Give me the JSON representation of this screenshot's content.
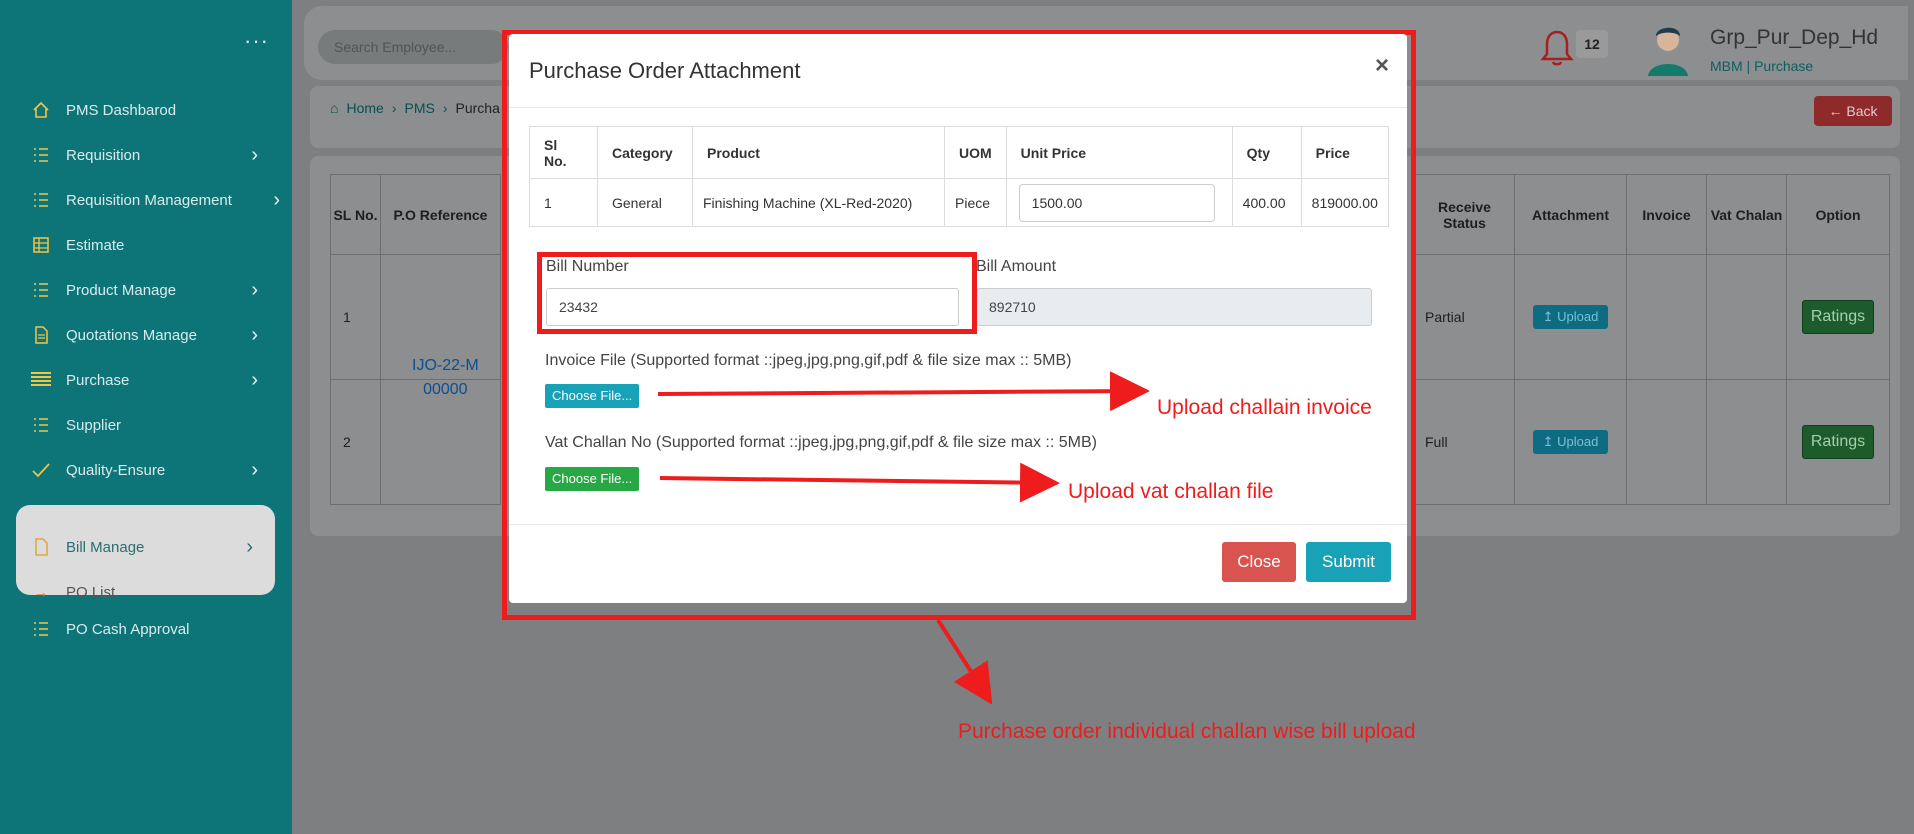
{
  "sidebar": {
    "items": [
      {
        "label": "PMS Dashbarod",
        "icon": "home-icon",
        "chevron": false
      },
      {
        "label": "Requisition",
        "icon": "list-icon",
        "chevron": true
      },
      {
        "label": "Requisition Management",
        "icon": "list-icon",
        "chevron": true
      },
      {
        "label": "Estimate",
        "icon": "table-icon",
        "chevron": false
      },
      {
        "label": "Product Manage",
        "icon": "list-icon",
        "chevron": true
      },
      {
        "label": "Quotations Manage",
        "icon": "document-icon",
        "chevron": true
      },
      {
        "label": "Purchase",
        "icon": "list-icon",
        "chevron": true
      },
      {
        "label": "Supplier",
        "icon": "list-icon",
        "chevron": false
      },
      {
        "label": "Quality-Ensure",
        "icon": "check-icon",
        "chevron": true
      }
    ],
    "active_item": {
      "label": "Bill Manage",
      "icon": "document-icon"
    },
    "sub_item": {
      "label": "PO List",
      "icon": "arrow-right-icon"
    },
    "extra_item": {
      "label": "PO Cash Approval",
      "icon": "list-icon"
    }
  },
  "header": {
    "search_placeholder": "Search Employee...",
    "notification_count": "12",
    "user_name": "Grp_Pur_Dep_Hd",
    "user_role": "MBM  | Purchase"
  },
  "breadcrumb": {
    "home": "Home",
    "pms": "PMS",
    "current": "Purcha"
  },
  "back_button": "Back",
  "background_table": {
    "left_headers": [
      "SL No.",
      "P.O Reference"
    ],
    "rows": [
      {
        "sl": "1"
      },
      {
        "sl": "2"
      }
    ],
    "po_reference": [
      "IJO-22-M",
      "00000"
    ],
    "right_headers": [
      "Receive Status",
      "Attachment",
      "Invoice",
      "Vat Chalan",
      "Option"
    ],
    "right_rows": [
      {
        "status": "Partial",
        "attachment": "Upload",
        "option": "Ratings"
      },
      {
        "status": "Full",
        "attachment": "Upload",
        "option": "Ratings"
      }
    ]
  },
  "modal": {
    "title": "Purchase Order Attachment",
    "close_symbol": "×",
    "table": {
      "headers": [
        "Sl No.",
        "Category",
        "Product",
        "UOM",
        "Unit Price",
        "Qty",
        "Price"
      ],
      "row": {
        "sl": "1",
        "category": "General",
        "product": "Finishing Machine (XL-Red-2020)",
        "uom": "Piece",
        "unit_price": "1500.00",
        "qty": "400.00",
        "price": "819000.00"
      }
    },
    "bill_number_label": "Bill Number",
    "bill_number_value": "23432",
    "bill_amount_label": "Bill Amount",
    "bill_amount_value": "892710",
    "invoice_file_label": "Invoice File (Supported format ::jpeg,jpg,png,gif,pdf & file size max :: 5MB)",
    "invoice_file_button": "Choose File...",
    "vat_challan_label": "Vat Challan No (Supported format ::jpeg,jpg,png,gif,pdf & file size max :: 5MB)",
    "vat_challan_button": "Choose File...",
    "close_button": "Close",
    "submit_button": "Submit"
  },
  "annotations": {
    "upload_invoice": "Upload challain invoice",
    "upload_vat": "Upload vat challan file",
    "caption": "Purchase order individual challan wise bill upload"
  },
  "colors": {
    "accent": "#17a2b8",
    "danger": "#d9534f",
    "success": "#28a745",
    "annotation": "#ee1c1c",
    "sidebar": "#0d7478"
  }
}
